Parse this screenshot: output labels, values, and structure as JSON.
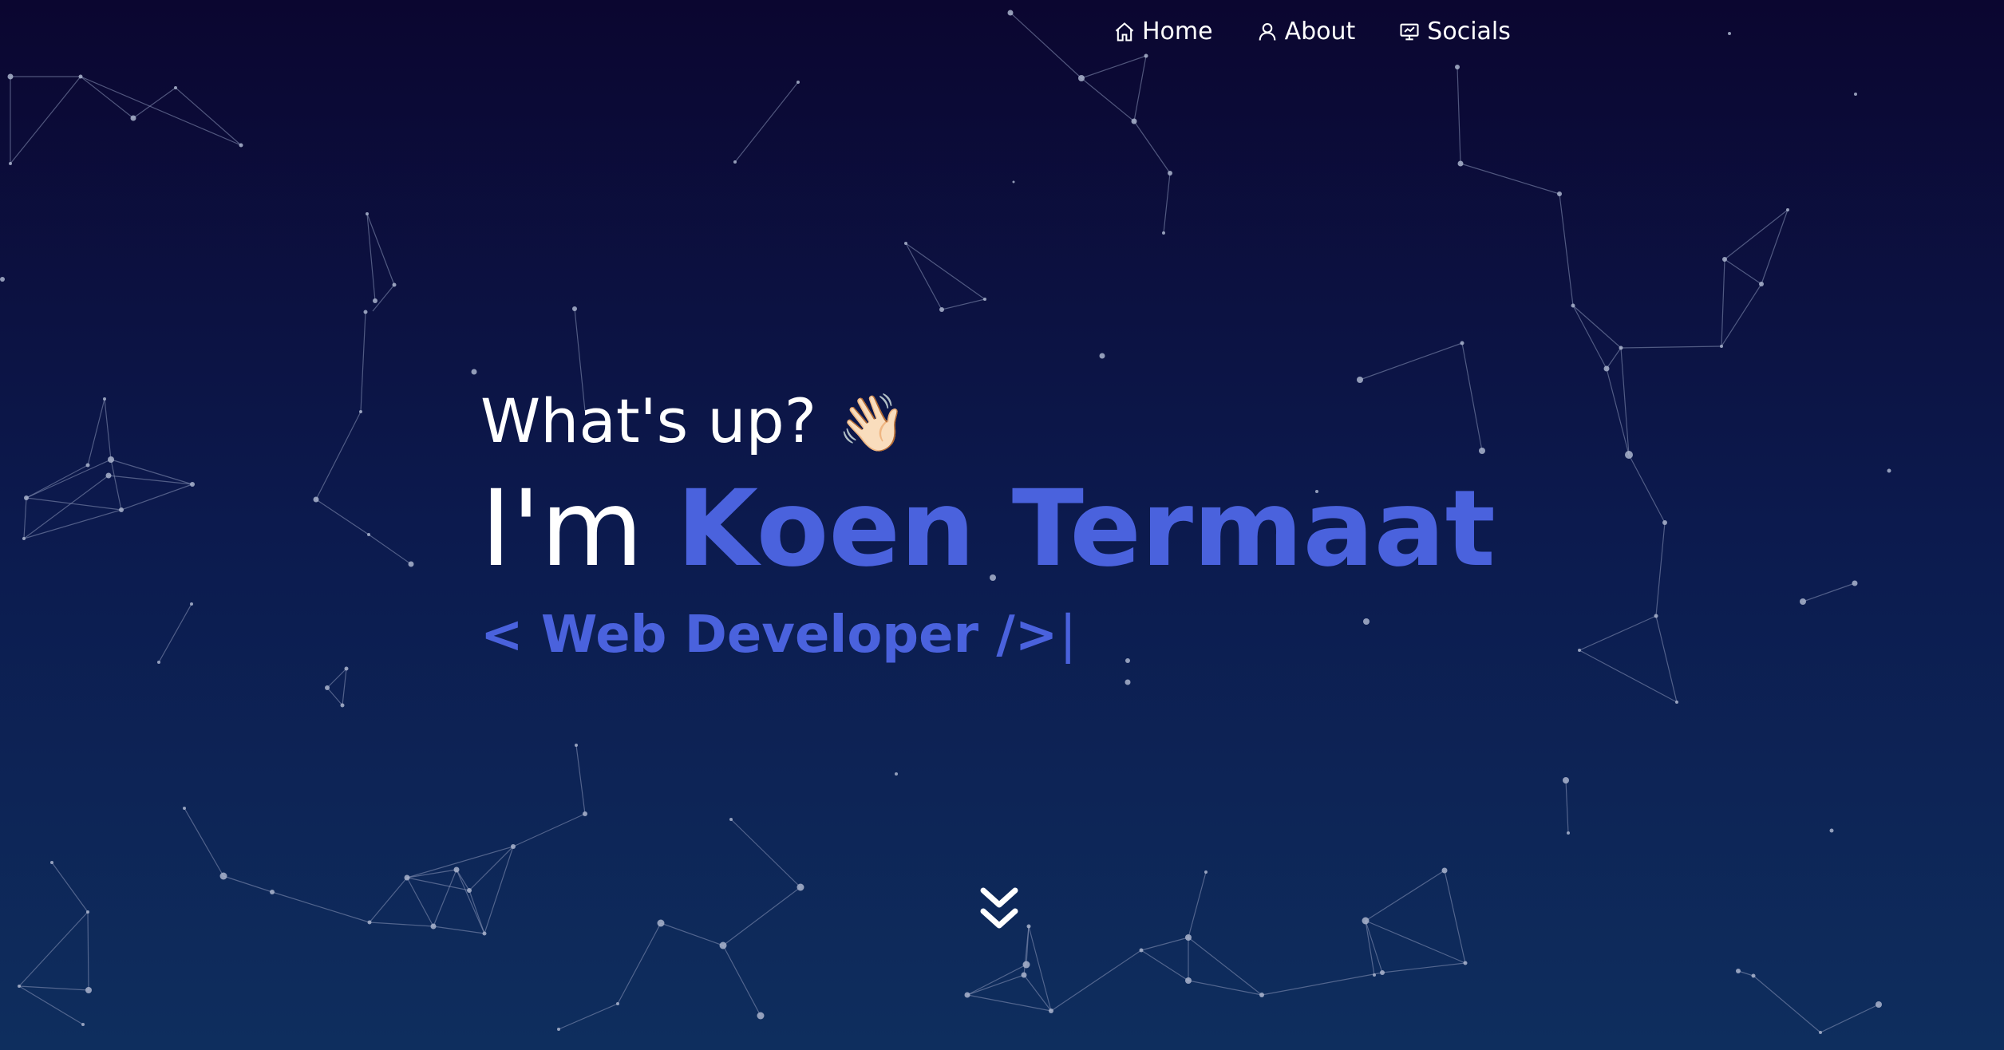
{
  "nav": {
    "items": [
      {
        "label": "Home",
        "icon": "home-icon"
      },
      {
        "label": "About",
        "icon": "user-icon"
      },
      {
        "label": "Socials",
        "icon": "presentation-icon"
      }
    ]
  },
  "hero": {
    "greeting": "What's up?",
    "wave_emoji": "👋🏻",
    "name_prefix": "I'm",
    "name": "Koen Termaat",
    "role": "< Web Developer />",
    "cursor": "|"
  },
  "colors": {
    "accent": "#4a62dd",
    "background_top": "#0b0630",
    "background_bottom": "#0e2e5e",
    "particle": "#aab4cc"
  },
  "scroll_icon": "double-chevron-down-icon"
}
